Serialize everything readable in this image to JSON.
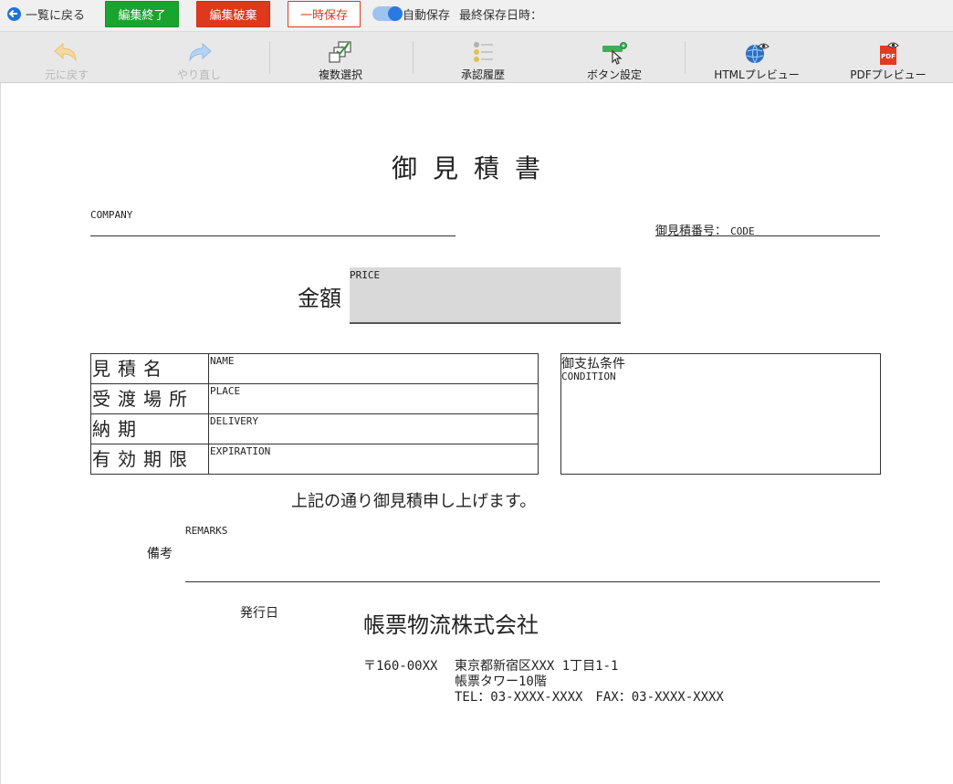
{
  "topbar": {
    "back_label": "一覧に戻る",
    "finish_label": "編集終了",
    "discard_label": "編集破棄",
    "tempsave_label": "一時保存",
    "autosave_label": "自動保存",
    "autosave_on": true,
    "lastsave_label": "最終保存日時："
  },
  "toolbar": {
    "items": [
      {
        "label": "元に戻す",
        "icon": "undo-icon",
        "enabled": false
      },
      {
        "label": "やり直し",
        "icon": "redo-icon",
        "enabled": false
      },
      {
        "label": "複数選択",
        "icon": "multi-select-icon",
        "enabled": true
      },
      {
        "label": "承認履歴",
        "icon": "approval-history-icon",
        "enabled": true
      },
      {
        "label": "ボタン設定",
        "icon": "button-settings-icon",
        "enabled": true
      },
      {
        "label": "HTMLプレビュー",
        "icon": "html-preview-icon",
        "enabled": true
      },
      {
        "label": "PDFプレビュー",
        "icon": "pdf-preview-icon",
        "enabled": true
      }
    ]
  },
  "document": {
    "title": "御見積書",
    "company_label": "COMPANY",
    "code_label": "御見積番号：",
    "code_value": "CODE",
    "amount_label": "金額",
    "price_label": "PRICE",
    "rows": [
      {
        "head": "見積名",
        "value": "NAME"
      },
      {
        "head": "受渡場所",
        "value": "PLACE"
      },
      {
        "head": "納期",
        "value": "DELIVERY"
      },
      {
        "head": "有効期限",
        "value": "EXPIRATION"
      }
    ],
    "condition_title": "御支払条件",
    "condition_value": "CONDITION",
    "note": "上記の通り御見積申し上げます。",
    "remarks_label": "REMARKS",
    "bikou_label": "備考",
    "issue_date_label": "発行日",
    "issuer_name": "帳票物流株式会社",
    "postal": "〒160-00XX",
    "address1": "東京都新宿区XXX 1丁目1-1",
    "address2": "帳票タワー10階",
    "tel_fax": "TEL：03-XXXX-XXXX　FAX：03-XXXX-XXXX"
  },
  "colors": {
    "finish_button": "#1aa32d",
    "discard_button": "#e0381a",
    "tempsave_border": "#d63a1f",
    "toggle": "#2a7ae2",
    "price_box": "#d9d9d9"
  }
}
